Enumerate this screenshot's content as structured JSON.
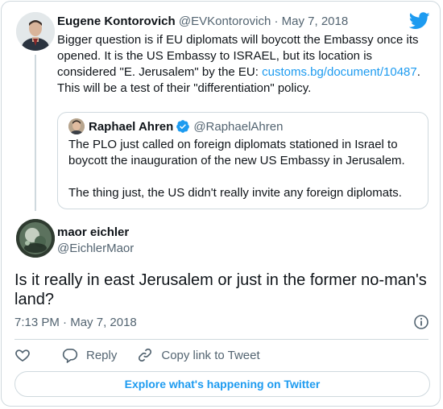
{
  "brand": {
    "accent": "#1d9bf0",
    "text": "#0f1419",
    "muted": "#536471",
    "border": "#cfd9de"
  },
  "parent_tweet": {
    "author_name": "Eugene Kontorovich",
    "author_handle": "@EVKontorovich",
    "separator": "·",
    "date": "May 7, 2018",
    "text_before_link": "Bigger question is if EU diplomats will boycott the Embassy once its opened. It is the US Embassy to ISRAEL, but its location is considered \"E. Jerusalem\" by the EU: ",
    "link": "customs.bg/document/10487",
    "text_after_link": ". This will be a test of their \"differentiation\" policy."
  },
  "quoted_tweet": {
    "author_name": "Raphael Ahren",
    "author_handle": "@RaphaelAhren",
    "verified_icon": "verified-badge-icon",
    "paragraph_1": "The PLO just called on foreign diplomats stationed in Israel to boycott the inauguration of the new US Embassy in Jerusalem.",
    "paragraph_2": "The thing just, the US didn't really invite any foreign diplomats."
  },
  "main_tweet": {
    "author_name": "maor eichler",
    "author_handle": "@EichlerMaor",
    "text": "Is it really in east Jerusalem or just in the former no-man's land?",
    "time": "7:13 PM",
    "date": "May 7, 2018",
    "time_separator": "·"
  },
  "actions": {
    "like_icon": "heart-icon",
    "reply_label": "Reply",
    "copy_label": "Copy link to Tweet"
  },
  "explore_button": "Explore what's happening on Twitter"
}
